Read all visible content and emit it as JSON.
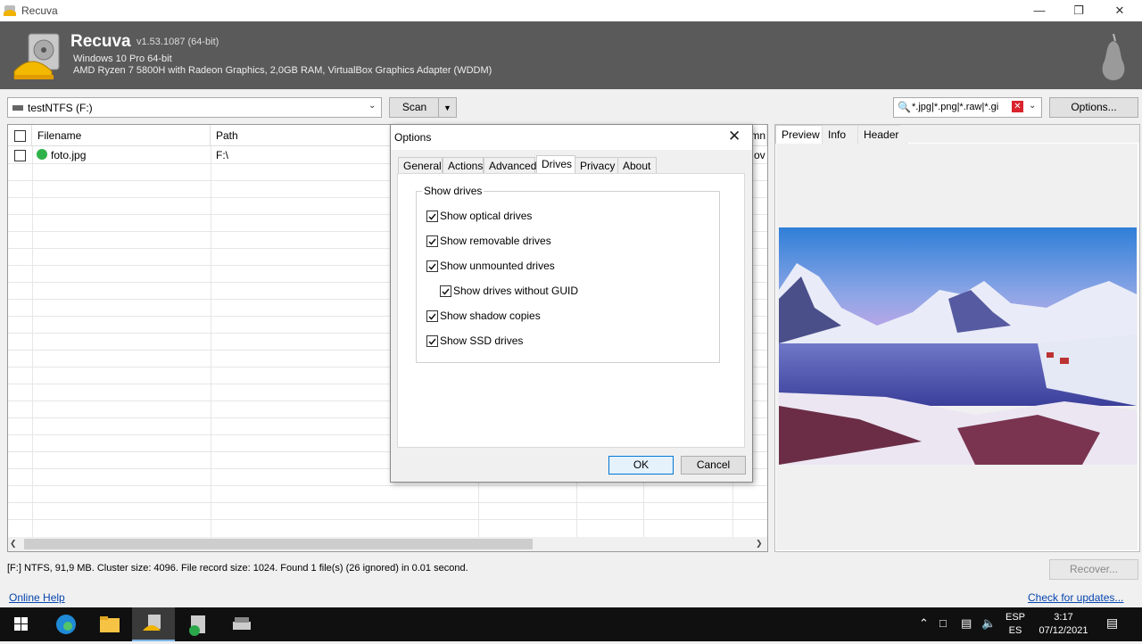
{
  "window": {
    "title": "Recuva"
  },
  "header": {
    "app_name": "Recuva",
    "version": "v1.53.1087 (64-bit)",
    "os": "Windows 10 Pro 64-bit",
    "hardware": "AMD Ryzen 7 5800H with Radeon Graphics, 2,0GB RAM, VirtualBox Graphics Adapter (WDDM)"
  },
  "toolbar": {
    "drive_value": "testNTFS (F:)",
    "scan_label": "Scan",
    "filter_value": "*.jpg|*.png|*.raw|*.gi",
    "options_label": "Options..."
  },
  "file_list": {
    "columns": [
      "Filename",
      "Path",
      "mn"
    ],
    "rows": [
      {
        "filename": "foto.jpg",
        "path": "F:\\",
        "extra": "ov"
      }
    ]
  },
  "preview_tabs": [
    "Preview",
    "Info",
    "Header"
  ],
  "dialog": {
    "title": "Options",
    "tabs": [
      "General",
      "Actions",
      "Advanced",
      "Drives",
      "Privacy",
      "About"
    ],
    "active_tab": "Drives",
    "group_label": "Show drives",
    "options": [
      {
        "label": "Show optical drives",
        "checked": true
      },
      {
        "label": "Show removable drives",
        "checked": true
      },
      {
        "label": "Show unmounted drives",
        "checked": true
      },
      {
        "label": "Show drives without GUID",
        "checked": true
      },
      {
        "label": "Show shadow copies",
        "checked": true
      },
      {
        "label": "Show SSD drives",
        "checked": true
      }
    ],
    "ok_label": "OK",
    "cancel_label": "Cancel"
  },
  "status": {
    "text": "[F:] NTFS, 91,9 MB. Cluster size: 4096. File record size: 1024. Found 1 file(s) (26 ignored) in 0.01 second.",
    "recover_label": "Recover..."
  },
  "footer": {
    "online_help": "Online Help",
    "check_updates": "Check for updates..."
  },
  "taskbar": {
    "lang_top": "ESP",
    "lang_bottom": "ES",
    "time": "3:17",
    "date": "07/12/2021"
  }
}
